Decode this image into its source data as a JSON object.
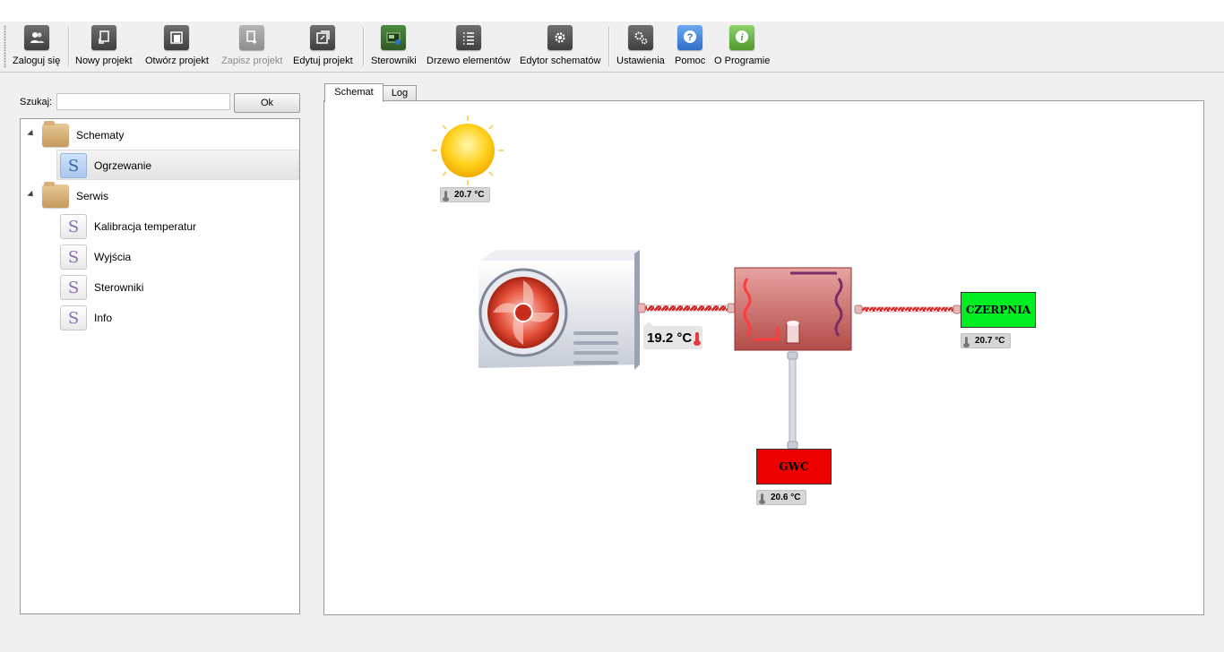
{
  "toolbar": {
    "items": [
      {
        "label": "Zaloguj się",
        "icon": "users-icon"
      },
      {
        "label": "Nowy projekt",
        "icon": "new-project-icon"
      },
      {
        "label": "Otwórz projekt",
        "icon": "open-project-icon"
      },
      {
        "label": "Zapisz projekt",
        "icon": "save-project-icon",
        "disabled": true
      },
      {
        "label": "Edytuj projekt",
        "icon": "edit-project-icon"
      },
      {
        "label": "Sterowniki",
        "icon": "controller-icon"
      },
      {
        "label": "Drzewo elementów",
        "icon": "list-icon"
      },
      {
        "label": "Edytor schematów",
        "icon": "gear-icon"
      },
      {
        "label": "Ustawienia",
        "icon": "settings-icon"
      },
      {
        "label": "Pomoc",
        "icon": "help-icon"
      },
      {
        "label": "O Programie",
        "icon": "info-icon"
      }
    ]
  },
  "search": {
    "label": "Szukaj:",
    "value": "",
    "ok_label": "Ok"
  },
  "tree": {
    "folders": [
      {
        "label": "Schematy",
        "items": [
          {
            "label": "Ogrzewanie",
            "selected": true
          }
        ]
      },
      {
        "label": "Serwis",
        "items": [
          {
            "label": "Kalibracja temperatur"
          },
          {
            "label": "Wyjścia"
          },
          {
            "label": "Sterowniki"
          },
          {
            "label": "Info"
          }
        ]
      }
    ]
  },
  "tabs": [
    {
      "label": "Schemat",
      "active": true
    },
    {
      "label": "Log",
      "active": false
    }
  ],
  "schema": {
    "outdoor_temp": "20.7 °C",
    "unit_temp": "19.2 °C",
    "czerpnia_label": "CZERPNIA",
    "czerpnia_temp": "20.7 °C",
    "gwc_label": "GWC",
    "gwc_temp": "20.6 °C",
    "colors": {
      "czerpnia": "#00ee22",
      "gwc": "#ee0000",
      "exchanger": "#c0504d"
    }
  }
}
